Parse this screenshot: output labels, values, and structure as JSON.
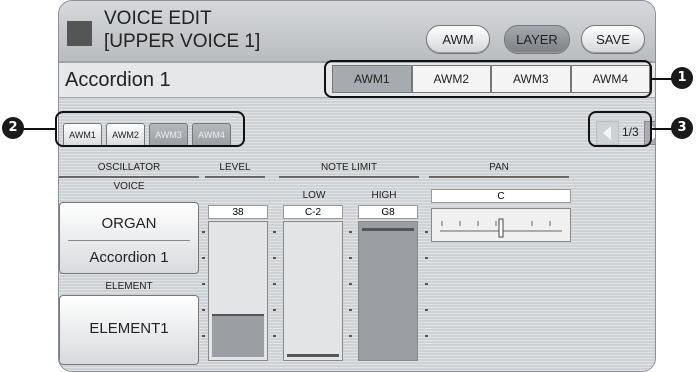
{
  "header": {
    "title_line1": "VOICE EDIT",
    "title_line2": "[UPPER VOICE 1]",
    "buttons": {
      "awm": "AWM",
      "layer": "LAYER",
      "save": "SAVE"
    }
  },
  "voice_name": "Accordion 1",
  "awm_tabs": [
    "AWM1",
    "AWM2",
    "AWM3",
    "AWM4"
  ],
  "element_buttons": [
    "AWM1",
    "AWM2",
    "AWM3",
    "AWM4"
  ],
  "page_indicator": "1/3",
  "sections": {
    "oscillator": "OSCILLATOR",
    "level": "LEVEL",
    "note_limit": "NOTE LIMIT",
    "pan": "PAN"
  },
  "sublabels": {
    "voice": "VOICE",
    "low": "LOW",
    "high": "HIGH",
    "element": "ELEMENT"
  },
  "values": {
    "level": "38",
    "low": "C-2",
    "high": "G8",
    "pan": "C"
  },
  "level_fill_fraction": 0.3,
  "voice_buttons": {
    "category": "ORGAN",
    "voice": "Accordion 1",
    "element": "ELEMENT1"
  },
  "callouts": [
    "1",
    "2",
    "3"
  ]
}
